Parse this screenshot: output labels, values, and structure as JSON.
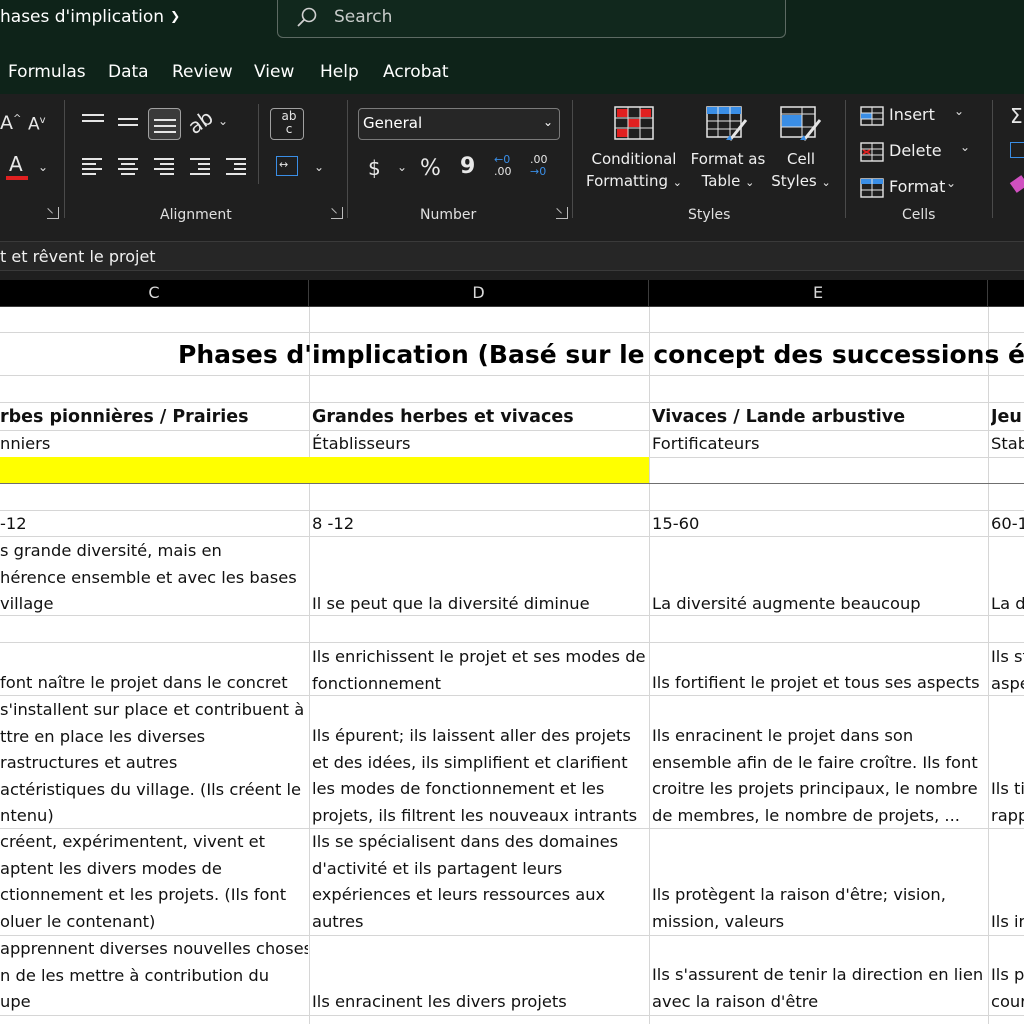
{
  "titlebar": {
    "doc_title": "hases d'implication",
    "search_placeholder": "Search"
  },
  "menu_tabs": [
    "Formulas",
    "Data",
    "Review",
    "View",
    "Help",
    "Acrobat"
  ],
  "ribbon": {
    "font": {
      "increase_size": "A",
      "decrease_size": "A",
      "font_color": "A"
    },
    "alignment": {
      "label": "Alignment",
      "wrap_text": "ab c"
    },
    "number": {
      "label": "Number",
      "format_value": "General",
      "currency": "$",
      "percent": "%",
      "comma": "9",
      "increase_decimal_top": "←0",
      "increase_decimal_bottom": ".00",
      "decrease_decimal_top": ".00",
      "decrease_decimal_bottom": "→0"
    },
    "styles": {
      "label": "Styles",
      "conditional_formatting": [
        "Conditional",
        "Formatting"
      ],
      "format_as_table": [
        "Format as",
        "Table"
      ],
      "cell_styles": [
        "Cell",
        "Styles"
      ]
    },
    "cells": {
      "label": "Cells",
      "insert": "Insert",
      "delete": "Delete",
      "format": "Format"
    },
    "colors": {
      "accent_red": "#e02020",
      "accent_blue": "#3a8ee6"
    }
  },
  "formula_bar": {
    "content": "t et rêvent le projet"
  },
  "columns": [
    "C",
    "D",
    "E"
  ],
  "sheet": {
    "title": "Phases d'implication (Basé sur le concept des successions éco",
    "highlight_color": "#ffff00",
    "rows": [
      {
        "c": [
          "rbes pionnières / Prairies"
        ],
        "d": [
          "Grandes herbes et vivaces"
        ],
        "e": [
          "Vivaces / Lande arbustive"
        ],
        "f": [
          "Jeu"
        ]
      },
      {
        "c": [
          "nniers"
        ],
        "d": [
          "Établisseurs"
        ],
        "e": [
          "Fortificateurs"
        ],
        "f": [
          "Stab"
        ]
      },
      {
        "c": [
          "-12"
        ],
        "d": [
          "8 -12"
        ],
        "e": [
          "15-60"
        ],
        "f": [
          "60-1"
        ]
      },
      {
        "c": [
          "s grande diversité, mais en",
          "hérence ensemble et avec les bases",
          "village"
        ],
        "d": [
          "Il se peut que la diversité diminue"
        ],
        "e": [
          "La diversité augmente beaucoup"
        ],
        "f": [
          "La d"
        ]
      },
      {
        "c": [
          "font naître le projet dans le concret"
        ],
        "d": [
          "Ils enrichissent le projet et ses modes de",
          "fonctionnement"
        ],
        "e": [
          "Ils fortifient le projet et tous ses aspects"
        ],
        "f": [
          "Ils st",
          "aspe"
        ]
      },
      {
        "c": [
          "s'installent sur place et contribuent à",
          "ttre en place les diverses",
          "rastructures et autres",
          "actéristiques du village. (Ils créent le",
          "ntenu)"
        ],
        "d": [
          "Ils épurent; ils laissent aller des projets",
          "et des idées, ils simplifient et clarifient",
          "les modes de fonctionnement et les",
          "projets, ils filtrent les nouveaux intrants"
        ],
        "e": [
          "Ils enracinent le projet dans son",
          "ensemble afin de le faire croître. Ils font",
          "croitre les projets principaux, le nombre",
          "de membres, le nombre de projets, ..."
        ],
        "f": [
          "Ils ti",
          "rapp"
        ]
      },
      {
        "c": [
          "créent, expérimentent, vivent et",
          "aptent les divers modes de",
          "ctionnement et les projets. (Ils font",
          "oluer le contenant)"
        ],
        "d": [
          "Ils se spécialisent dans des domaines",
          "d'activité et ils partagent leurs",
          "expériences et leurs ressources aux",
          "autres"
        ],
        "e": [
          "Ils protègent la raison d'être; vision,",
          "mission, valeurs"
        ],
        "f": [
          "Ils in"
        ]
      },
      {
        "c": [
          "apprennent diverses nouvelles choses",
          "n de les mettre à contribution du",
          "upe"
        ],
        "d": [
          "Ils enracinent les divers projets"
        ],
        "e": [
          "Ils s'assurent de tenir la direction en lien",
          "avec la raison d'être"
        ],
        "f": [
          "Ils p",
          "cour"
        ]
      }
    ]
  }
}
